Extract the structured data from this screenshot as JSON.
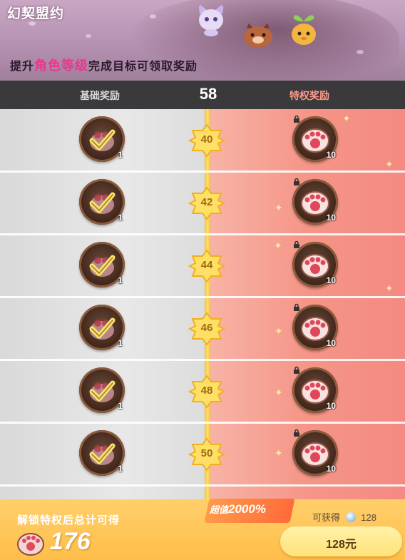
{
  "banner": {
    "title": "幻契盟约",
    "subtitle_pre": "提升",
    "subtitle_highlight": "角色等级",
    "subtitle_post": "完成目标可领取奖励"
  },
  "header": {
    "basic_label": "基础奖励",
    "current_level": "58",
    "premium_label": "特权奖励"
  },
  "rows": [
    {
      "level": "40",
      "basic_qty": "1",
      "premium_qty": "10",
      "basic_icon": "claimed-check-icon",
      "premium_icon": "paw-token-icon",
      "premium_locked": true
    },
    {
      "level": "42",
      "basic_qty": "1",
      "premium_qty": "10",
      "basic_icon": "claimed-check-icon",
      "premium_icon": "paw-token-icon",
      "premium_locked": true
    },
    {
      "level": "44",
      "basic_qty": "1",
      "premium_qty": "10",
      "basic_icon": "claimed-check-icon",
      "premium_icon": "paw-token-icon",
      "premium_locked": true
    },
    {
      "level": "46",
      "basic_qty": "1",
      "premium_qty": "10",
      "basic_icon": "claimed-check-icon",
      "premium_icon": "paw-token-icon",
      "premium_locked": true
    },
    {
      "level": "48",
      "basic_qty": "1",
      "premium_qty": "10",
      "basic_icon": "claimed-check-icon",
      "premium_icon": "paw-token-icon",
      "premium_locked": true
    },
    {
      "level": "50",
      "basic_qty": "1",
      "premium_qty": "10",
      "basic_icon": "claimed-check-icon",
      "premium_icon": "paw-token-icon",
      "premium_locked": true
    }
  ],
  "footer": {
    "unlock_text": "解锁特权后总计可得",
    "total": "176",
    "promo_pre": "超值",
    "promo_value": "2000%",
    "avail_label": "可获得",
    "avail_count": "128",
    "buy_label": "128元"
  },
  "colors": {
    "premium_col": "#f59587",
    "basic_col": "#e0e0e0",
    "track": "#ffd84a",
    "footer": "#ffc85a",
    "highlight": "#e8378c"
  }
}
